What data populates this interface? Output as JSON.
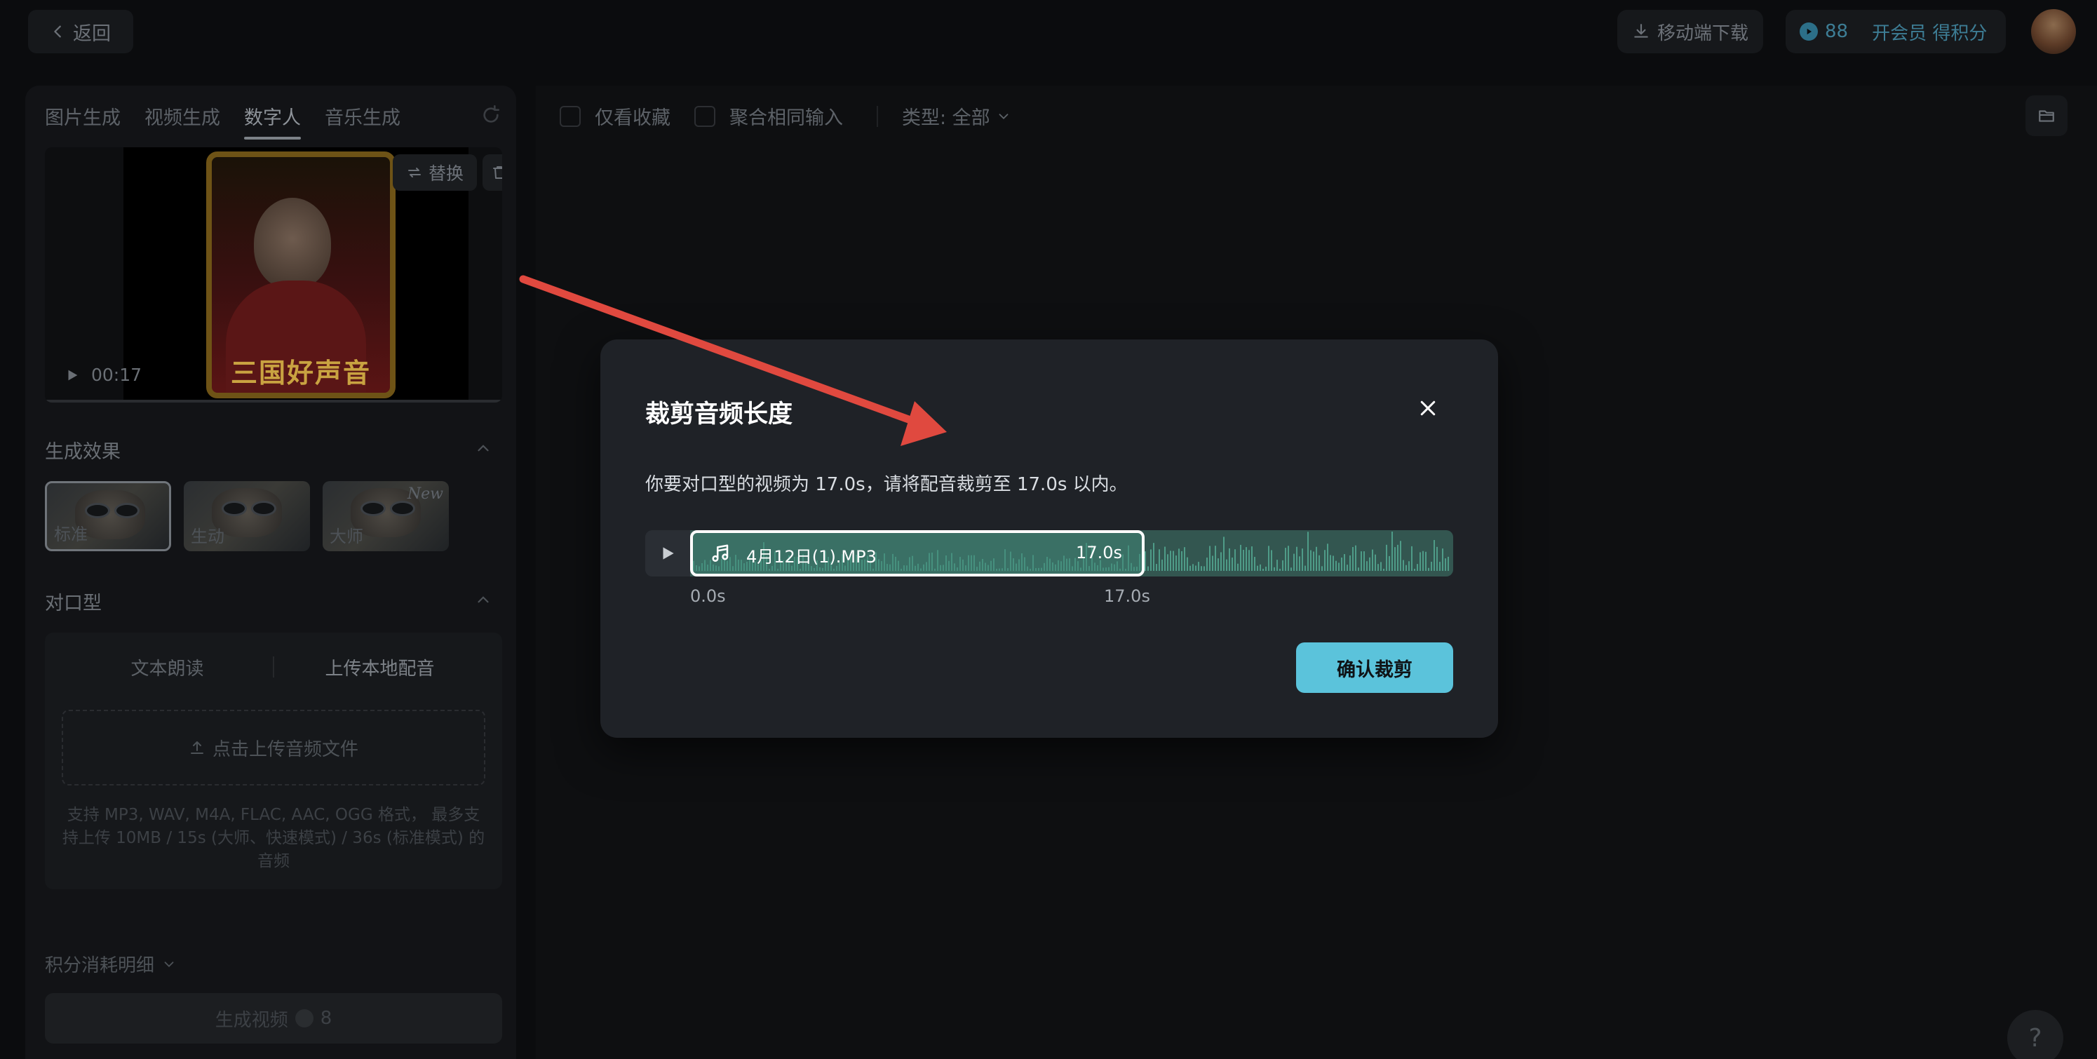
{
  "topbar": {
    "back_label": "返回",
    "mobile_download_label": "移动端下载",
    "points": "88",
    "vip_label": "开会员 得积分"
  },
  "left_panel": {
    "tabs": [
      {
        "label": "图片生成",
        "active": false
      },
      {
        "label": "视频生成",
        "active": false
      },
      {
        "label": "数字人",
        "active": true
      },
      {
        "label": "音乐生成",
        "active": false
      }
    ],
    "video": {
      "banner_text": "三国好声音",
      "replace_label": "替换",
      "duration": "00:17"
    },
    "effect_section": {
      "title": "生成效果",
      "cards": [
        {
          "label": "标准",
          "selected": true,
          "badge": ""
        },
        {
          "label": "生动",
          "selected": false,
          "badge": ""
        },
        {
          "label": "大师",
          "selected": false,
          "badge": "New"
        }
      ]
    },
    "lip_section": {
      "title": "对口型",
      "tabs": [
        {
          "label": "文本朗读",
          "active": false
        },
        {
          "label": "上传本地配音",
          "active": true
        }
      ],
      "upload_label": "点击上传音频文件",
      "upload_hint": "支持 MP3, WAV, M4A, FLAC, AAC, OGG 格式， 最多支持上传 10MB / 15s (大师、快速模式) / 36s (标准模式) 的音频"
    },
    "cost_detail_label": "积分消耗明细",
    "generate": {
      "label": "生成视频",
      "cost": "8"
    }
  },
  "main_panel": {
    "filters": {
      "favorites_label": "仅看收藏",
      "merge_label": "聚合相同输入",
      "type_label": "类型: 全部"
    }
  },
  "help_label": "?",
  "modal": {
    "title": "裁剪音频长度",
    "description": "你要对口型的视频为 17.0s，请将配音裁剪至 17.0s 以内。",
    "track": {
      "filename": "4月12日(1).MP3",
      "selection_duration": "17.0s",
      "tick_start": "0.0s",
      "tick_end": "17.0s"
    },
    "confirm_label": "确认裁剪"
  },
  "colors": {
    "accent": "#5bc3db",
    "wave": "#4f9c88",
    "annotation_arrow": "#e0493f"
  }
}
